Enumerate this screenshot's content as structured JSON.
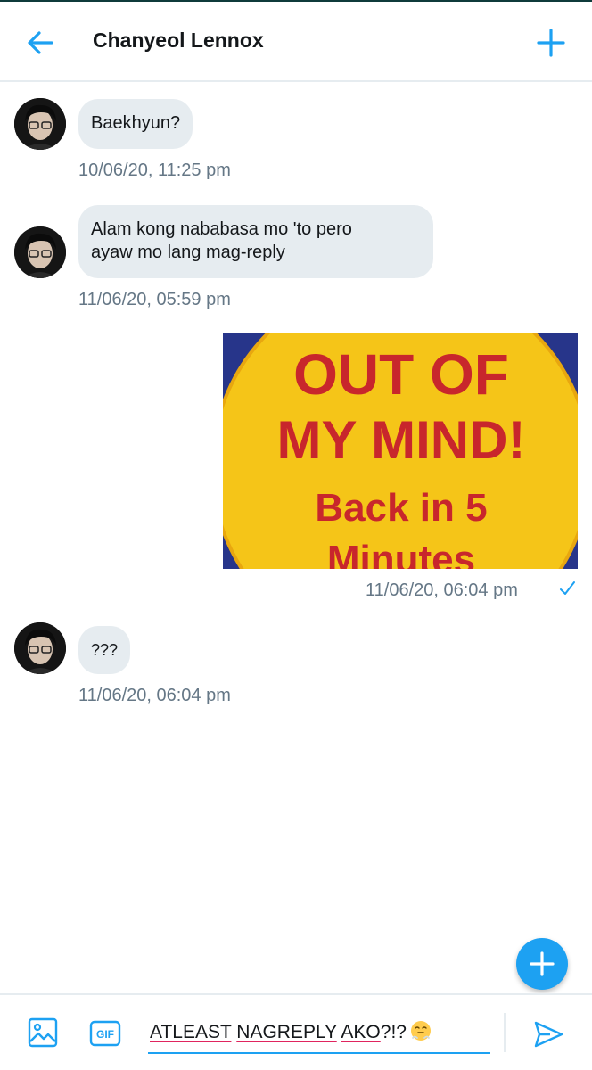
{
  "header": {
    "title": "Chanyeol Lennox",
    "back_icon": "arrow-left-icon",
    "new_icon": "plus-icon",
    "accent": "#1da1f2"
  },
  "messages": [
    {
      "direction": "received",
      "text": "Baekhyun?",
      "timestamp": "10/06/20, 11:25 pm"
    },
    {
      "direction": "received",
      "text": "Alam kong nababasa mo 'to pero\nayaw mo lang mag-reply",
      "timestamp": "11/06/20, 05:59 pm"
    },
    {
      "direction": "sent",
      "image": {
        "line1": "OUT OF",
        "line2": "MY MIND!",
        "line3": "Back in 5",
        "line4": "Minutes"
      },
      "timestamp": "11/06/20, 06:04 pm",
      "status_icon": "check-icon"
    },
    {
      "direction": "received",
      "text": "???",
      "timestamp": "11/06/20, 06:04 pm"
    }
  ],
  "composer": {
    "words": [
      "ATLEAST",
      "NAGREPLY",
      "AKO"
    ],
    "punct": "?!?",
    "emoji": "huffing-face-emoji",
    "image_icon": "image-icon",
    "gif_label": "GIF",
    "send_icon": "send-icon"
  },
  "fab": {
    "icon": "plus-icon"
  },
  "colors": {
    "bubble": "#e6ecf0",
    "timestamp": "#657786",
    "spellcheck": "#e0245e"
  }
}
